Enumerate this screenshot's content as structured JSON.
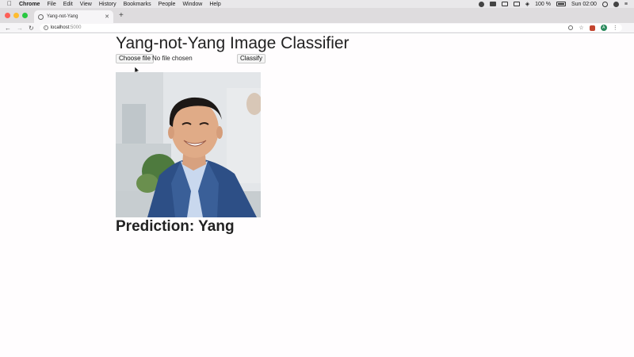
{
  "menubar": {
    "app": "Chrome",
    "items": [
      "File",
      "Edit",
      "View",
      "History",
      "Bookmarks",
      "People",
      "Window",
      "Help"
    ],
    "battery": "100 %",
    "clock": "Sun 02:00"
  },
  "browser": {
    "tab_title": "Yang-not-Yang",
    "url_host": "localhost",
    "url_port": ":5000",
    "profile_initial": "A"
  },
  "page": {
    "title": "Yang-not-Yang Image Classifier",
    "choose_file_label": "Choose file",
    "file_status": "No file chosen",
    "classify_label": "Classify",
    "prediction_label": "Prediction: Yang"
  },
  "colors": {
    "menubar_bg": "#e9e8ea",
    "tabstrip_bg": "#dedcde",
    "toolbar_bg": "#f6f5f7",
    "suit": "#2d4f86",
    "shirt": "#c9d8ee"
  }
}
